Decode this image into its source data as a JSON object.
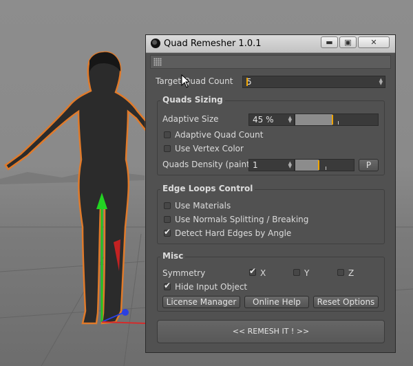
{
  "window": {
    "title": "Quad Remesher 1.0.1",
    "close_symbol": "✕",
    "min_symbol": "▬",
    "max_symbol": "▣"
  },
  "target": {
    "label": "Target Quad Count",
    "value": "5"
  },
  "quads_sizing": {
    "title": "Quads Sizing",
    "adaptive_size": {
      "label": "Adaptive Size",
      "value": "45 %",
      "fraction": 0.45
    },
    "adaptive_quad_count": {
      "label": "Adaptive Quad Count",
      "checked": false
    },
    "use_vertex_color": {
      "label": "Use Vertex Color",
      "checked": false
    },
    "quads_density": {
      "label": "Quads Density (paint)",
      "value": "1",
      "fraction": 0.4,
      "p_button": "P"
    }
  },
  "edge_loops": {
    "title": "Edge Loops Control",
    "use_materials": {
      "label": "Use Materials",
      "checked": false
    },
    "use_normals": {
      "label": "Use Normals Splitting / Breaking",
      "checked": false
    },
    "detect_hard_edges": {
      "label": "Detect Hard Edges by Angle",
      "checked": true
    }
  },
  "misc": {
    "title": "Misc",
    "symmetry_label": "Symmetry",
    "x": {
      "label": "X",
      "checked": true
    },
    "y": {
      "label": "Y",
      "checked": false
    },
    "z": {
      "label": "Z",
      "checked": false
    },
    "hide_input": {
      "label": "Hide Input Object",
      "checked": true
    },
    "license_button": "License Manager",
    "help_button": "Online Help",
    "reset_button": "Reset Options"
  },
  "remesh_button": "<<   REMESH IT !   >>",
  "colors": {
    "accent": "#f0a500",
    "panel": "#515151",
    "mesh_outline": "#e07a2a"
  }
}
